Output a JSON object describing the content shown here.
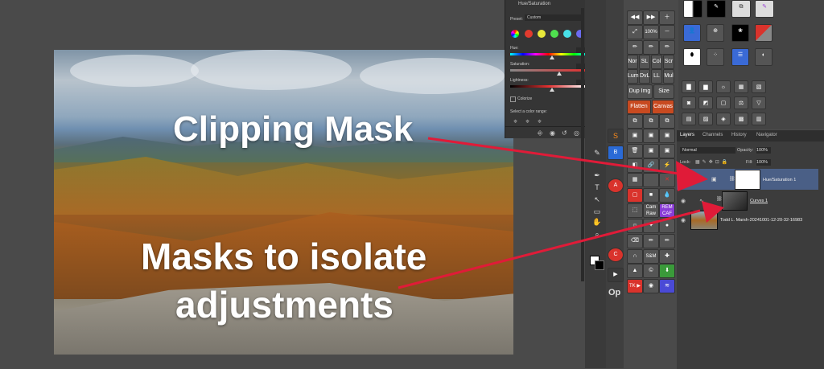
{
  "annotations": {
    "clipping_mask": "Clipping Mask",
    "masks_line1": "Masks to isolate",
    "masks_line2": "adjustments",
    "arrow_color": "#e01b38"
  },
  "properties": {
    "title": "Hue/Saturation",
    "preset_label": "Preset:",
    "preset_value": "Custom",
    "hue_label": "Hue:",
    "hue_value": "0",
    "saturation_label": "Saturation:",
    "saturation_value": "+19",
    "lightness_label": "Lightness:",
    "lightness_value": "0",
    "colorize_label": "Colorize",
    "select_range_label": "Select a color range:"
  },
  "toolbar_buttons": {
    "nor": "Nor",
    "sl": "SL",
    "col": "Col",
    "scr": "Scr",
    "lum": "Lum",
    "dvl": "DvL",
    "ll": "LL",
    "mul": "Mul",
    "dup_img": "Dup Img",
    "size": "Size",
    "flatten": "Flatten",
    "canvas": "Canvas",
    "cam_raw": "Cam Raw",
    "rem_caf": "REM CAF",
    "s_and_m": "S&M",
    "tk": "TK ▶",
    "op": "Op",
    "zoom_100": "100%"
  },
  "layers_panel": {
    "tabs": [
      "Layers",
      "Channels",
      "History",
      "Navigator"
    ],
    "blend_mode": "Normal",
    "opacity_label": "Opacity:",
    "opacity_value": "100%",
    "lock_label": "Lock:",
    "fill_label": "Fill:",
    "fill_value": "100%",
    "layers": [
      {
        "name": "Hue/Saturation 1",
        "selected": true
      },
      {
        "name": "Curves 1",
        "selected": false
      },
      {
        "name": "Todd L. Marsh-20241001-12-20-32-16983",
        "selected": false
      }
    ]
  }
}
